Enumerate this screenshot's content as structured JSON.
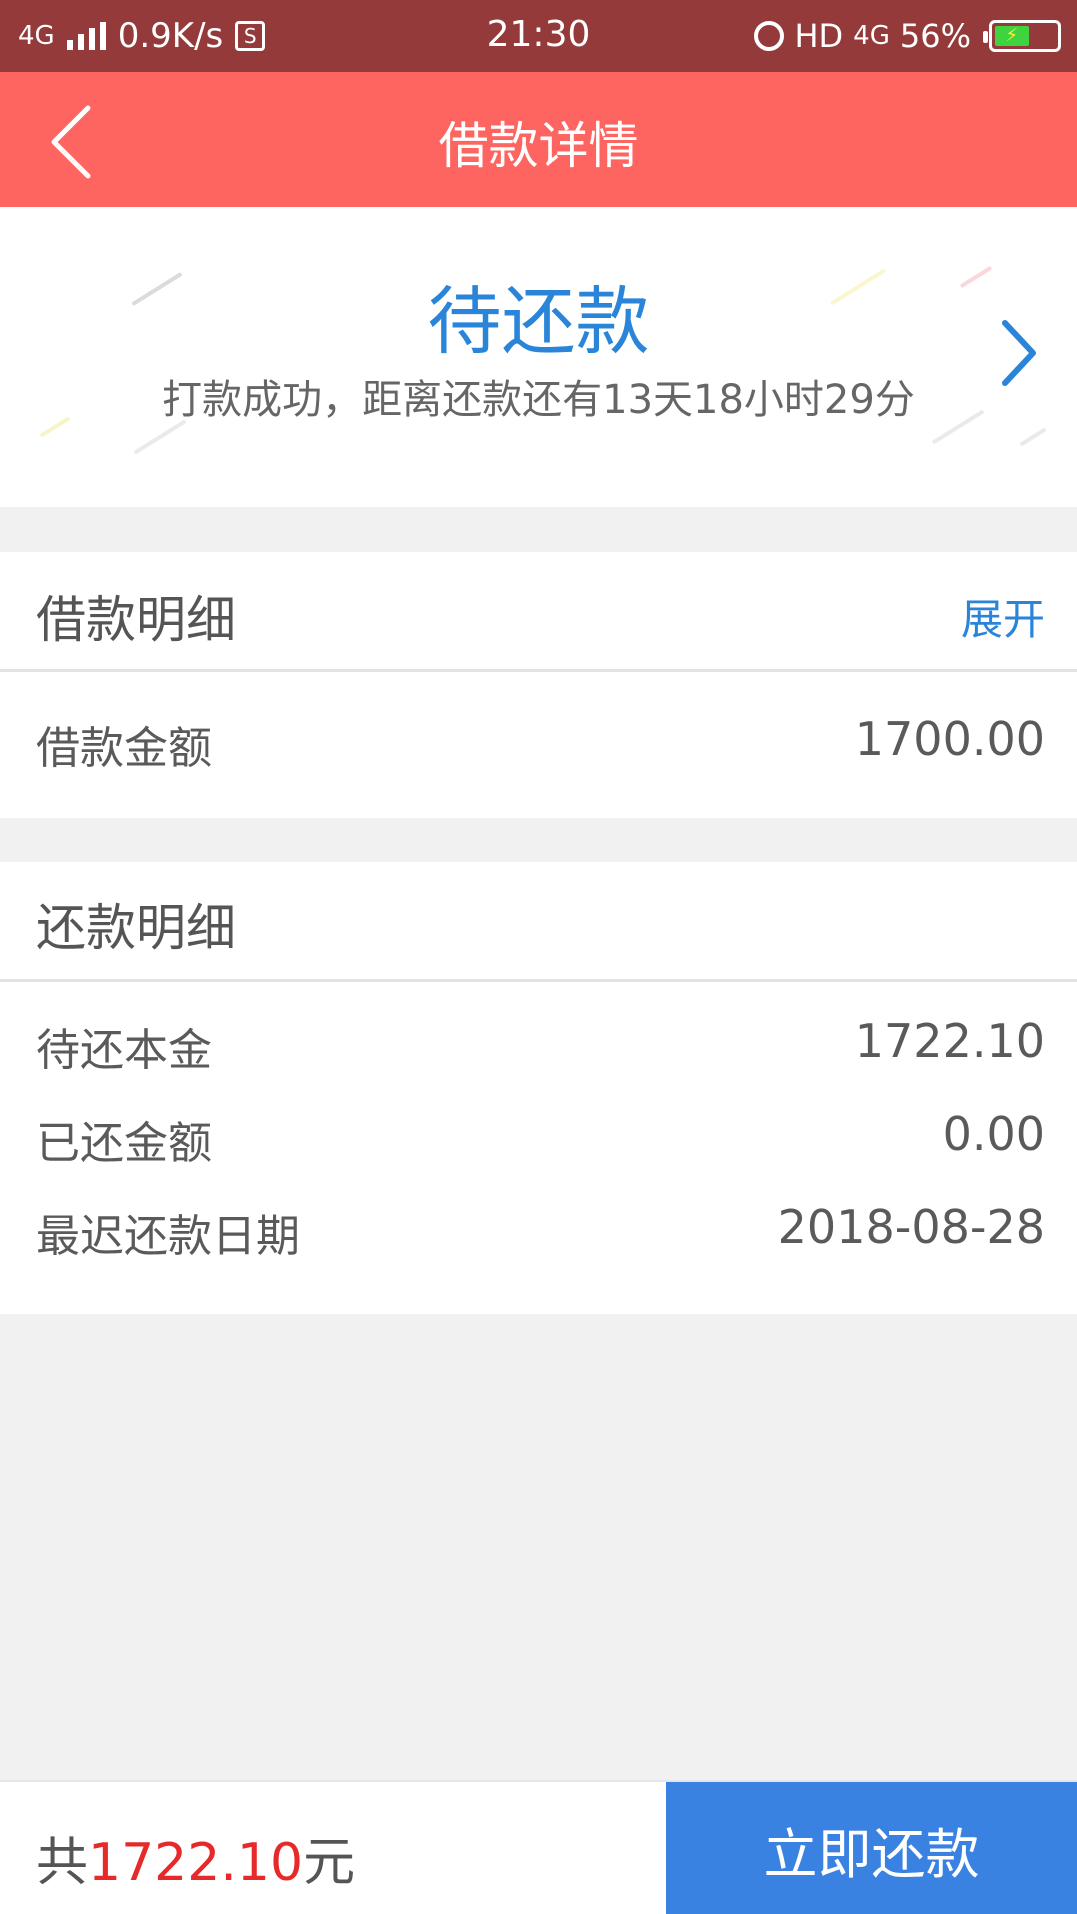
{
  "status_bar": {
    "network": "4G",
    "speed": "0.9K/s",
    "sim_icon": "S",
    "time": "21:30",
    "hd": "HD",
    "network2": "4G",
    "battery": "56%",
    "battery_level": 0.56
  },
  "header": {
    "title": "借款详情"
  },
  "status": {
    "title": "待还款",
    "description": "打款成功，距离还款还有13天18小时29分"
  },
  "loan_detail": {
    "title": "借款明细",
    "expand_label": "展开",
    "rows": [
      {
        "label": "借款金额",
        "value": "1700.00"
      }
    ]
  },
  "repay_detail": {
    "title": "还款明细",
    "rows": [
      {
        "label": "待还本金",
        "value": "1722.10"
      },
      {
        "label": "已还金额",
        "value": "0.00"
      },
      {
        "label": "最迟还款日期",
        "value": "2018-08-28"
      }
    ]
  },
  "bottom": {
    "total_prefix": "共",
    "total_amount": "1722.10",
    "total_suffix": "元",
    "button_label": "立即还款"
  },
  "colors": {
    "status_bar": "#953a3a",
    "header": "#fe6561",
    "accent_blue": "#2a85d8",
    "button_blue": "#3a82e2",
    "amount_red": "#e62a2a"
  }
}
